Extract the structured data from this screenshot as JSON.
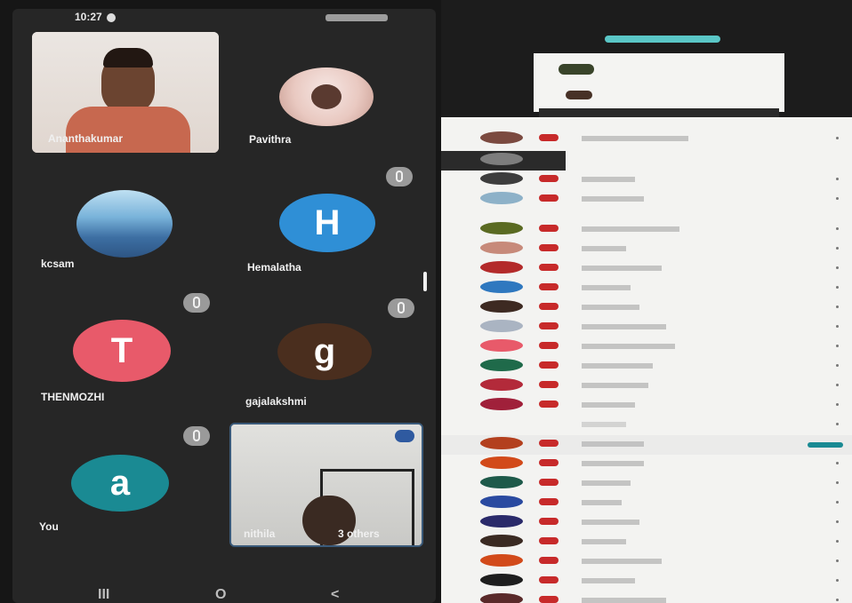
{
  "phone": {
    "status_time": "10:27",
    "participants": [
      {
        "name": "Ananthakumar",
        "type": "video"
      },
      {
        "name": "Pavithra",
        "type": "photo"
      },
      {
        "name": "kcsam",
        "type": "photo"
      },
      {
        "name": "Hemalatha",
        "initial": "H",
        "color": "#2f8fd6"
      },
      {
        "name": "THENMOZHI",
        "initial": "T",
        "color": "#e85a6a"
      },
      {
        "name": "gajalakshmi",
        "initial": "g",
        "color": "#4a2e1e"
      },
      {
        "name": "You",
        "initial": "a",
        "color": "#1a8a93"
      }
    ],
    "group_tile": {
      "name": "nithila",
      "others": "3 others"
    },
    "nav": {
      "recent": "III",
      "home": "O",
      "back": "<"
    }
  },
  "laptop": {
    "panel_rows": 24
  }
}
